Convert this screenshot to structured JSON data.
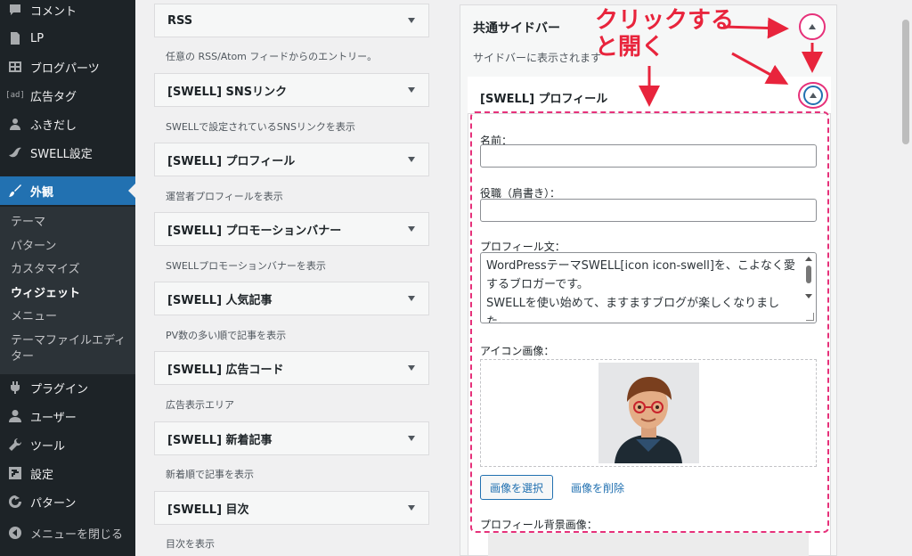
{
  "sidebar": {
    "items": [
      {
        "label": "コメント",
        "icon": "comment-icon"
      },
      {
        "label": "LP",
        "icon": "page-icon"
      },
      {
        "label": "ブログパーツ",
        "icon": "grid-icon"
      },
      {
        "label": "広告タグ",
        "icon": "ad-icon",
        "icon_text": "[ad]"
      },
      {
        "label": "ふきだし",
        "icon": "person-icon"
      },
      {
        "label": "SWELL設定",
        "icon": "swell-icon"
      },
      {
        "label": "外観",
        "icon": "brush-icon"
      },
      {
        "label": "プラグイン",
        "icon": "plugin-icon"
      },
      {
        "label": "ユーザー",
        "icon": "user-icon"
      },
      {
        "label": "ツール",
        "icon": "wrench-icon"
      },
      {
        "label": "設定",
        "icon": "settings-icon"
      },
      {
        "label": "パターン",
        "icon": "pattern-icon"
      },
      {
        "label": "メニューを閉じる",
        "icon": "collapse-icon"
      }
    ],
    "submenu": [
      "テーマ",
      "パターン",
      "カスタマイズ",
      "ウィジェット",
      "メニュー",
      "テーマファイルエディター"
    ],
    "active_item": "外観",
    "current_sub": "ウィジェット"
  },
  "available_widgets": [
    {
      "title": "RSS",
      "desc": "任意の RSS/Atom フィードからのエントリー。"
    },
    {
      "title": "[SWELL] SNSリンク",
      "desc": "SWELLで設定されているSNSリンクを表示"
    },
    {
      "title": "[SWELL] プロフィール",
      "desc": "運営者プロフィールを表示"
    },
    {
      "title": "[SWELL] プロモーションバナー",
      "desc": "SWELLプロモーションバナーを表示"
    },
    {
      "title": "[SWELL] 人気記事",
      "desc": "PV数の多い順で記事を表示"
    },
    {
      "title": "[SWELL] 広告コード",
      "desc": "広告表示エリア"
    },
    {
      "title": "[SWELL] 新着記事",
      "desc": "新着順で記事を表示"
    },
    {
      "title": "[SWELL] 目次",
      "desc": "目次を表示"
    }
  ],
  "panel": {
    "title": "共通サイドバー",
    "desc": "サイドバーに表示されます"
  },
  "profile_widget": {
    "title": "[SWELL] プロフィール",
    "name_label": "名前：",
    "name_value": "",
    "role_label": "役職（肩書き）：",
    "role_value": "",
    "bio_label": "プロフィール文：",
    "bio_text": "WordPressテーマSWELL[icon icon-swell]を、こよなく愛するブロガーです。\nSWELLを使い始めて、ますますブログが楽しくなりました。",
    "icon_label": "アイコン画像：",
    "select_button": "画像を選択",
    "remove_button": "画像を削除",
    "bg_label": "プロフィール背景画像："
  },
  "annotation": {
    "text": "クリックする\nと開く",
    "color": "#e8243c"
  },
  "colors": {
    "admin_bg": "#1d2327",
    "active": "#2271b1",
    "annotation_frame": "#e6317a"
  }
}
